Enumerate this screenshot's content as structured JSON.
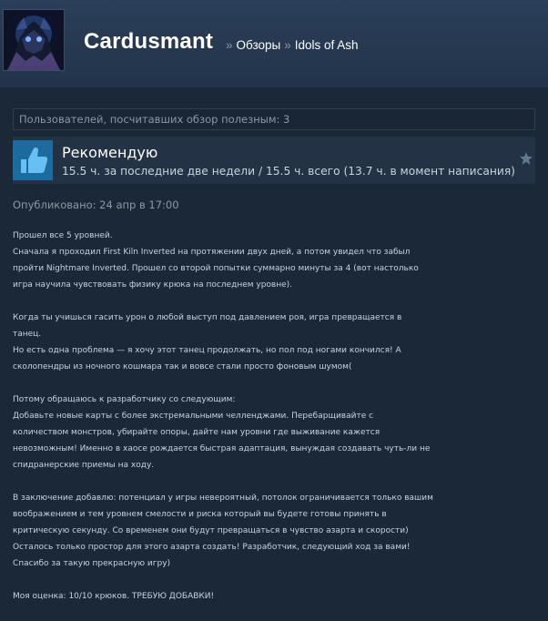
{
  "header": {
    "persona_name": "Cardusmant",
    "breadcrumb": {
      "separator": "»",
      "items": [
        "Обзоры",
        "Idols of Ash"
      ]
    }
  },
  "review": {
    "helpful_text": "Пользователей, посчитавших обзор полезным: 3",
    "recommendation": "Рекомендую",
    "hours": "15.5 ч. за последние две недели / 15.5 ч. всего (13.7 ч. в момент написания)",
    "posted": "Опубликовано: 24 апр в 17:00",
    "body_paragraphs": [
      [
        "Прошел все 5 уровней.",
        "Сначала я проходил First Kiln Inverted на протяжении двух дней, а потом увидел что забыл",
        "пройти Nightmare Inverted. Прошел со второй попытки суммарно минуты за 4 (вот настолько",
        "игра научила чувствовать физику крюка на последнем уровне)."
      ],
      [
        "Когда ты учишься гасить урон о любой выступ под давлением роя, игра превращается в",
        "танец.",
        "Но есть одна проблема — я хочу этот танец продолжать, но пол под ногами кончился! А",
        "сколопендры из ночного кошмара так и вовсе стали просто фоновым шумом("
      ],
      [
        "Потому обращаюсь к разработчику со следующим:",
        "Добавьте новые карты с более экстремальными челленджами. Перебарщивайте с",
        "количеством монстров, убирайте опоры, дайте нам уровни где выживание кажется",
        "невозможным! Именно в хаосе рождается быстрая адаптация, вынуждая создавать чуть-ли не",
        "спидранерские приемы на ходу."
      ],
      [
        "В заключение добавлю: потенциал у игры невероятный, потолок ограничивается только вашим",
        "воображением и тем уровнем смелости и риска который вы будете готовы принять в",
        "критическую секунду. Со временем они будут превращаться в чувство азарта и скорости)",
        "Осталось только простор для этого азарта создать! Разработчик, следующий ход за вами!",
        "Спасибо за такую прекрасную игру)"
      ],
      [
        "Моя оценка: 10/10 крюков. ТРЕБУЮ ДОБАВКИ!"
      ]
    ]
  },
  "icons": {
    "thumb": "thumbs-up-icon",
    "award": "star-icon",
    "avatar": "avatar-image"
  },
  "colors": {
    "background": "#1b2838",
    "header": "#26384f",
    "thumb_bg": "#1c6b9e",
    "text": "#c6d4df",
    "muted": "#8f98a0"
  }
}
